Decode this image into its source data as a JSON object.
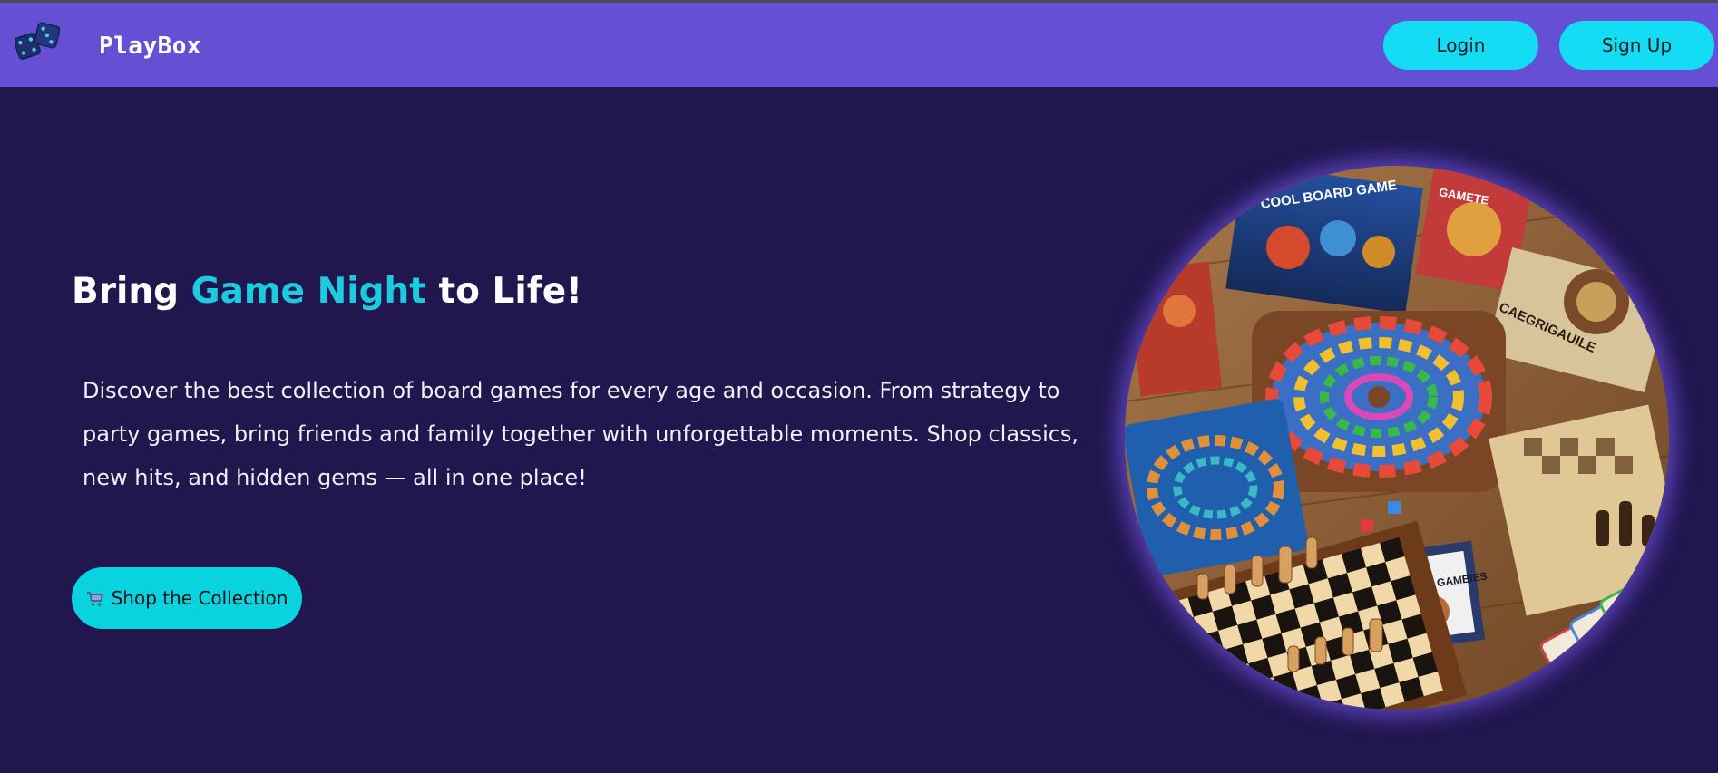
{
  "navbar": {
    "logo_icon": "dice-icon",
    "brand": "PlayBox",
    "login_label": "Login",
    "signup_label": "Sign Up"
  },
  "hero": {
    "title_before": "Bring ",
    "title_accent": "Game Night",
    "title_after": " to Life!",
    "description": "Discover the best collection of board games for every age and occasion. From strategy to party games, bring friends and family together with unforgettable moments. Shop classics, new hits, and hidden gems — all in one place!",
    "cta_icon": "shopping-cart-icon",
    "cta_label": "Shop the Collection",
    "image": "board-games-collection-photo",
    "image_box_texts": [
      "COOL BOARD GAME",
      "GAMETE",
      "CAEGRIGAUILE",
      "YOUT GAMBIES"
    ]
  },
  "colors": {
    "background": "#22164f",
    "navbar": "#654fd4",
    "accent": "#1ccbe0",
    "button": "#13dcf4"
  }
}
